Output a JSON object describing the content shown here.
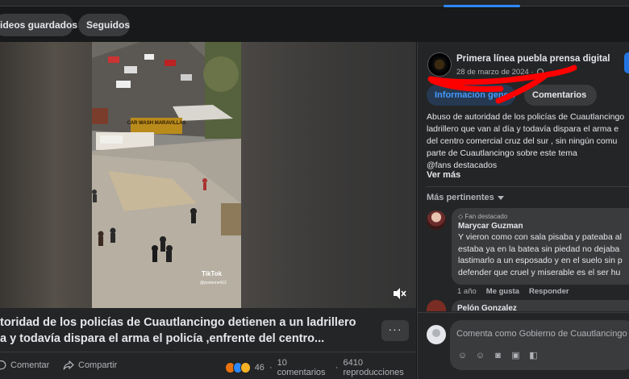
{
  "chips": {
    "saved": "ideos guardados",
    "followed": "Seguidos"
  },
  "video": {
    "watermark": "TikTok",
    "watermark_user": "@ponteme412",
    "sign_text": "CAR WASH MARAVILLAS"
  },
  "post": {
    "title_line1": "toridad de los policías de Cuautlancingo detienen a un ladrillero",
    "title_line2": "a y todavía dispara el arma el policía ,enfrente del centro...",
    "more": "···",
    "comment_label": "Comentar",
    "share_label": "Compartir",
    "reaction_count": "46",
    "comments_count": "10 comentarios",
    "views": "6410 reproducciones",
    "separator": "·"
  },
  "page": {
    "name": "Primera línea puebla prensa digital",
    "date": "28 de marzo de 2024 ·"
  },
  "tabs": {
    "info": "Información general",
    "comments": "Comentarios"
  },
  "description": {
    "lines": [
      "Abuso de autoridad de los policías de Cuautlancingo",
      "ladrillero que van al día y todavía dispara el arma e",
      "del centro comercial cruz del sur , sin ningún comu",
      "parte de Cuautlancingo sobre este tema",
      "@fans destacados"
    ],
    "see_more": "Ver más"
  },
  "comments": {
    "sort_label": "Más pertinentes",
    "first": {
      "badge": "Fan destacado",
      "name": "Marycar Guzman",
      "lines": [
        "Y vieron como con sala pisaba y pateaba al",
        "estaba ya en la batea sin piedad no dejaba",
        "lastimarlo a un esposado y en el suelo sin p",
        "defender que cruel y miserable es el ser hu"
      ],
      "time": "1 año",
      "like": "Me gusta",
      "reply": "Responder"
    },
    "second": {
      "name": "Pelón Gonzalez"
    },
    "compose_placeholder": "Comenta como Gobierno de Cuautlancingo"
  },
  "colors": {
    "background": "#18191a",
    "panel": "#242526",
    "accent": "#2d88ff",
    "scribble": "#ff0000"
  }
}
